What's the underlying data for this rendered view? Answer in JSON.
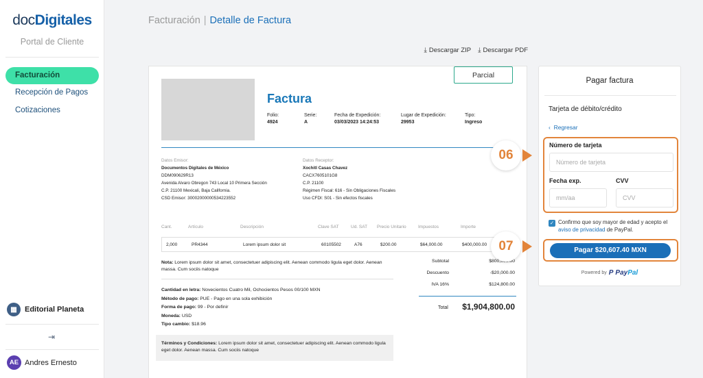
{
  "sidebar": {
    "logo_doc": "doc",
    "logo_digitales": "Digitales",
    "portal": "Portal de Cliente",
    "items": [
      {
        "label": "Facturación"
      },
      {
        "label": "Recepción de Pagos"
      },
      {
        "label": "Cotizaciones"
      }
    ],
    "org": "Editorial Planeta",
    "user_initials": "AE",
    "user_name": "Andres Ernesto"
  },
  "header": {
    "breadcrumb_parent": "Facturación",
    "breadcrumb_sep": "|",
    "breadcrumb_current": "Detalle de Factura",
    "download_zip": "Descargar ZIP",
    "download_pdf": "Descargar PDF"
  },
  "invoice": {
    "status": "Parcial",
    "title": "Factura",
    "meta": [
      {
        "label": "Folio:",
        "value": "4924"
      },
      {
        "label": "Serie:",
        "value": "A"
      },
      {
        "label": "Fecha de Expedición:",
        "value": "03/03/2023 14:24:53"
      },
      {
        "label": "Lugar de Expedición:",
        "value": "29953"
      },
      {
        "label": "Tipo:",
        "value": "Ingreso"
      }
    ],
    "emisor": {
      "label": "Datos Emisor:",
      "name": "Documentos Digitales de México",
      "lines": [
        "DDM090629R13",
        "Avenida Alvaro Obregon 743 Local 10 Primera Sección",
        "C.P. 21100 Mexicali, Baja California.",
        "CSD Emisor: 30002000000534223552"
      ]
    },
    "receptor": {
      "label": "Datos Receptor:",
      "name": "Xochitl Casas Chavez",
      "lines": [
        "CACX7605101G8",
        "C.P. 21100",
        "Régimen Fiscal: 616 - Sin Obligaciones Fiscales",
        "Uso CFDI: S01 - Sin efectos fiscales"
      ]
    },
    "columns": [
      "Cant.",
      "Artículo",
      "Descripción",
      "Clave SAT",
      "Ud. SAT",
      "Precio Unitario",
      "Impuestos",
      "Importe"
    ],
    "rows": [
      [
        "2,000",
        "PR4344",
        "Lorem ipsum dolor sit",
        "60105502",
        "A76",
        "$200.00",
        "$64,000.00",
        "$400,000.00"
      ]
    ],
    "nota_label": "Nota:",
    "nota": "Lorem ipsum dolor sit amet, consectetuer adipiscing elit. Aenean commodo ligula eget dolor. Aenean massa. Cum sociis natoque",
    "extra": [
      {
        "label": "Cantidad en letra:",
        "value": "Novecientos Cuatro Mil, Ochocientos Pesos 00/100 MXN"
      },
      {
        "label": "Método de pago:",
        "value": "PUE - Pago en una sola exhibición"
      },
      {
        "label": "Forma de pago:",
        "value": "99 - Por definir"
      },
      {
        "label": "Moneda:",
        "value": "USD"
      },
      {
        "label": "Tipo cambio:",
        "value": "$18.96"
      }
    ],
    "terms_label": "Términos y Condiciones:",
    "terms": "Lorem ipsum dolor sit amet, consectetuer adipiscing elit. Aenean commodo ligula eget dolor. Aenean massa. Cum sociis natoque",
    "totals": [
      {
        "label": "Subtotal",
        "value": "$800,000.00"
      },
      {
        "label": "Descuento",
        "value": "-$20,000.00"
      },
      {
        "label": "IVA 16%",
        "value": "$124,800.00"
      }
    ],
    "total_label": "Total",
    "total_value": "$1,904,800.00"
  },
  "pay": {
    "title": "Pagar factura",
    "subtitle": "Tarjeta de débito/crédito",
    "back": "Regresar",
    "card_label": "Número de tarjeta",
    "card_placeholder": "Número de tarjeta",
    "exp_label": "Fecha exp.",
    "exp_placeholder": "mm/aa",
    "cvv_label": "CVV",
    "cvv_placeholder": "CVV",
    "consent_pre": "Confirmo que soy mayor de edad y acepto el ",
    "consent_link": "aviso de privacidad",
    "consent_post": " de PayPal.",
    "button": "Pagar $20,607.40 MXN",
    "powered": "Powered by",
    "paypal_a": "Pay",
    "paypal_b": "Pal"
  },
  "callouts": {
    "first": "06",
    "second": "07"
  },
  "colors": {
    "accent": "#1a6fb8",
    "active_nav": "#3ee0a8",
    "highlight": "#e2843a"
  }
}
